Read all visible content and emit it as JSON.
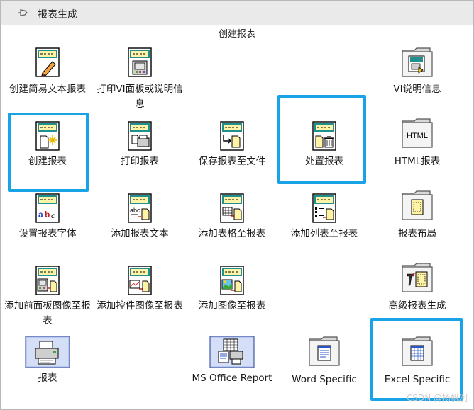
{
  "palette": {
    "title": "报表生成",
    "section_title": "创建报表"
  },
  "items": {
    "create_easy_text_report": "创建简易文本报表",
    "print_vi_panel": "打印VI面板或说明信息",
    "vi_documentation": "VI说明信息",
    "new_report": "创建报表",
    "print_report": "打印报表",
    "save_report_to_file": "保存报表至文件",
    "dispose_report": "处置报表",
    "html_report": "HTML报表",
    "set_report_font": "设置报表字体",
    "append_report_text": "添加报表文本",
    "append_table_to_report": "添加表格至报表",
    "append_list_to_report": "添加列表至报表",
    "report_layout": "报表布局",
    "append_front_panel_image": "添加前面板图像至报表",
    "append_control_image": "添加控件图像至报表",
    "append_image_to_report": "添加图像至报表",
    "advanced_report_generation": "高级报表生成",
    "report": "报表",
    "ms_office_report": "MS Office Report",
    "word_specific": "Word Specific",
    "excel_specific": "Excel Specific"
  },
  "icon_text": {
    "html_folder": "HTML",
    "abc": "abc",
    "abc_colored": [
      "a",
      "b",
      "c"
    ]
  },
  "colors": {
    "highlight": "#19a3e6",
    "icon_yellow": "#fff3a8",
    "icon_teal": "#1f8f8f"
  },
  "watermark": "CSDN @扬帆冽"
}
